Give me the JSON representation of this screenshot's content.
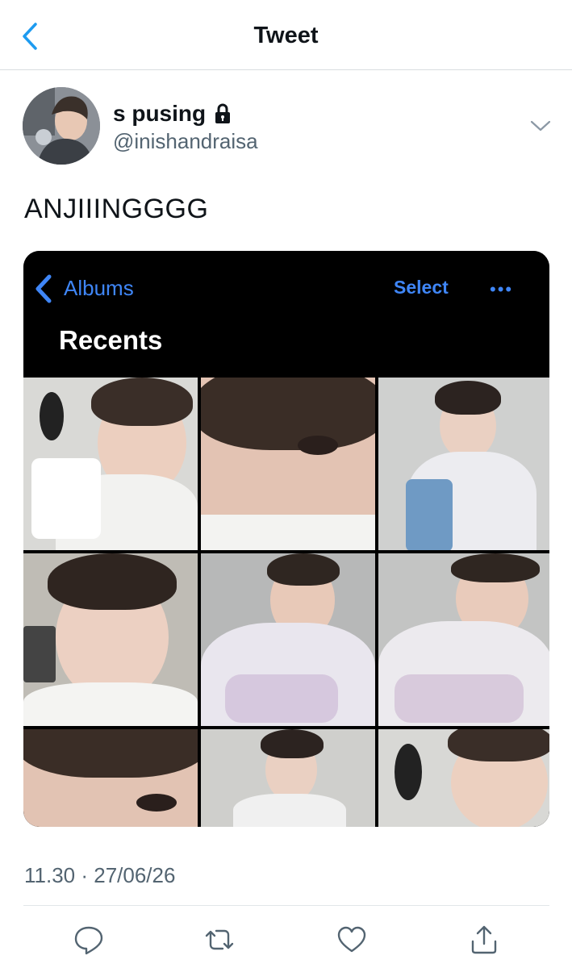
{
  "header": {
    "title": "Tweet"
  },
  "author": {
    "name": "s pusing",
    "handle": "@inishandraisa"
  },
  "tweet": {
    "text": "ANJIIINGGGG",
    "timestamp": "11.30 · 27/06/26"
  },
  "embedded_screenshot": {
    "back_label": "Albums",
    "select_label": "Select",
    "more_label": "•••",
    "title": "Recents"
  },
  "colors": {
    "accent": "#1d9bf0",
    "ios_blue": "#3f86f7",
    "muted": "#536471"
  },
  "icons": [
    "back-chevron-icon",
    "lock-icon",
    "chevron-down-icon",
    "reply-icon",
    "retweet-icon",
    "like-icon",
    "share-icon"
  ]
}
